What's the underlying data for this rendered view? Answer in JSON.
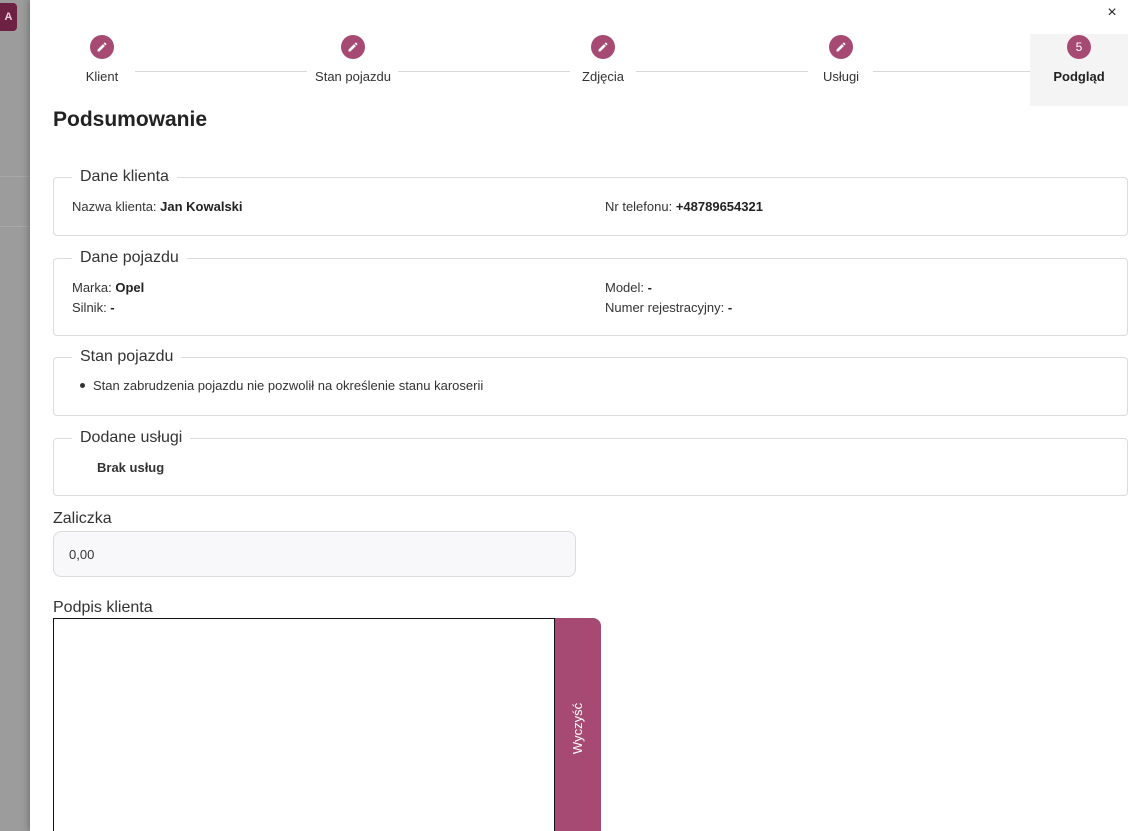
{
  "background_app": {
    "logo_letter": "A"
  },
  "stepper": {
    "steps": [
      {
        "label": "Klient",
        "icon": "pencil-icon"
      },
      {
        "label": "Stan pojazdu",
        "icon": "pencil-icon"
      },
      {
        "label": "Zdjęcia",
        "icon": "pencil-icon"
      },
      {
        "label": "Usługi",
        "icon": "pencil-icon"
      },
      {
        "label": "Podgląd",
        "number": "5"
      }
    ],
    "accent_color": "#a64a74"
  },
  "close_label": "×",
  "title": "Podsumowanie",
  "client": {
    "legend": "Dane klienta",
    "name_label": "Nazwa klienta: ",
    "name_value": "Jan Kowalski",
    "phone_label": "Nr telefonu: ",
    "phone_value": "+48789654321"
  },
  "vehicle": {
    "legend": "Dane pojazdu",
    "make_label": "Marka: ",
    "make_value": "Opel",
    "model_label": "Model: ",
    "model_value": "-",
    "engine_label": "Silnik: ",
    "engine_value": "-",
    "plate_label": "Numer rejestracyjny: ",
    "plate_value": "-"
  },
  "condition": {
    "legend": "Stan pojazdu",
    "items": [
      "Stan zabrudzenia pojazdu nie pozwolił na określenie stanu karoserii"
    ]
  },
  "services": {
    "legend": "Dodane usługi",
    "empty_text": "Brak usług"
  },
  "deposit": {
    "label": "Zaliczka",
    "value": "0,00"
  },
  "signature": {
    "label": "Podpis klienta",
    "clear_label": "Wyczyść"
  }
}
